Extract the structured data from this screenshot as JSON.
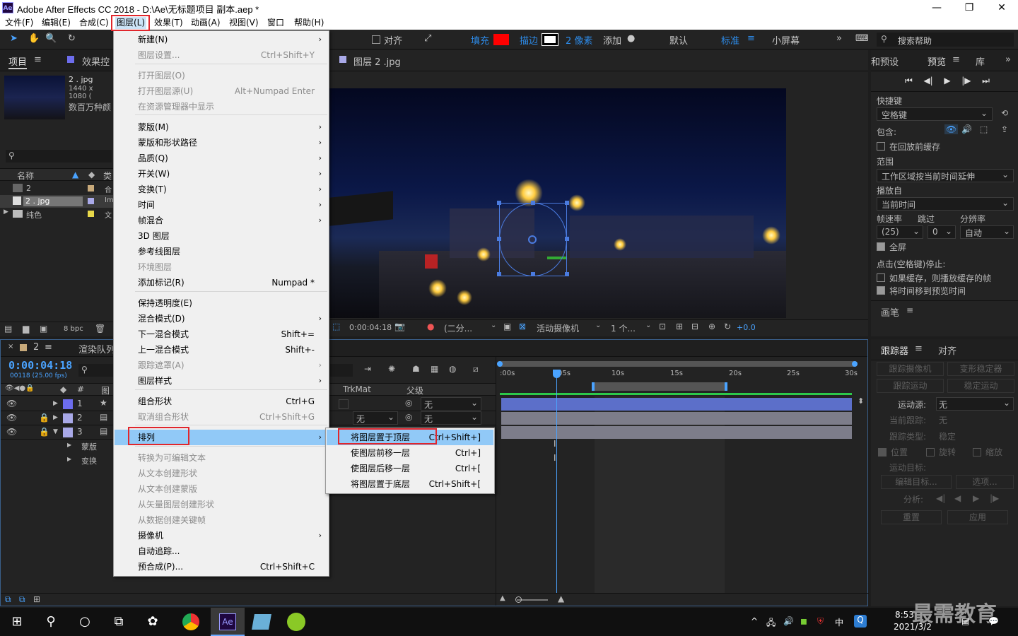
{
  "window": {
    "title": "Adobe After Effects CC 2018 - D:\\Ae\\无标题项目 副本.aep *",
    "logo": "Ae",
    "minimize": "—",
    "maximize": "❐",
    "close": "✕"
  },
  "menubar": [
    "文件(F)",
    "编辑(E)",
    "合成(C)",
    "图层(L)",
    "效果(T)",
    "动画(A)",
    "视图(V)",
    "窗口",
    "帮助(H)"
  ],
  "toolbar": {
    "align": "对齐",
    "fill": "填充",
    "stroke": "描边",
    "stroke_px": "2 像素",
    "add": "添加",
    "default": "默认",
    "standard": "标准",
    "small_screen": "小屏幕",
    "search_placeholder": "搜索帮助"
  },
  "project": {
    "tab": "项目",
    "effects_tab": "效果控",
    "item_name": "2 . jpg",
    "item_dims": "1440 x 1080 (",
    "item_desc": "数百万种颜",
    "col_name": "名称",
    "col_type": "类",
    "bpc": "8 bpc",
    "items": [
      {
        "name": "2",
        "t": "合"
      },
      {
        "name": "2 . jpg",
        "t": "Im"
      },
      {
        "name": "纯色",
        "t": "文"
      }
    ]
  },
  "comp_viewer": {
    "tab": "图层 2 .jpg",
    "timecode": "0:00:04:18",
    "resolution": "(二分...",
    "camera": "活动摄像机",
    "views": "1 个...",
    "exposure": "+0.0"
  },
  "layer_menu": {
    "items": [
      {
        "label": "新建(N)",
        "arrow": true
      },
      {
        "label": "图层设置...",
        "shortcut": "Ctrl+Shift+Y",
        "disabled": true
      },
      {
        "label": "打开图层(O)",
        "disabled": true
      },
      {
        "label": "打开图层源(U)",
        "shortcut": "Alt+Numpad Enter",
        "disabled": true
      },
      {
        "label": "在资源管理器中显示",
        "disabled": true
      },
      {
        "label": "蒙版(M)",
        "arrow": true
      },
      {
        "label": "蒙版和形状路径",
        "arrow": true
      },
      {
        "label": "品质(Q)",
        "arrow": true
      },
      {
        "label": "开关(W)",
        "arrow": true
      },
      {
        "label": "变换(T)",
        "arrow": true
      },
      {
        "label": "时间",
        "arrow": true
      },
      {
        "label": "帧混合",
        "arrow": true
      },
      {
        "label": "3D 图层"
      },
      {
        "label": "参考线图层"
      },
      {
        "label": "环境图层",
        "disabled": true
      },
      {
        "label": "添加标记(R)",
        "shortcut": "Numpad *"
      },
      {
        "label": "保持透明度(E)"
      },
      {
        "label": "混合模式(D)",
        "arrow": true
      },
      {
        "label": "下一混合模式",
        "shortcut": "Shift+="
      },
      {
        "label": "上一混合模式",
        "shortcut": "Shift+-"
      },
      {
        "label": "跟踪遮罩(A)",
        "arrow": true,
        "disabled": true
      },
      {
        "label": "图层样式",
        "arrow": true
      },
      {
        "label": "组合形状",
        "shortcut": "Ctrl+G"
      },
      {
        "label": "取消组合形状",
        "shortcut": "Ctrl+Shift+G",
        "disabled": true
      },
      {
        "label": "排列",
        "arrow": true
      },
      {
        "label": "转换为可编辑文本",
        "disabled": true
      },
      {
        "label": "从文本创建形状",
        "disabled": true
      },
      {
        "label": "从文本创建蒙版",
        "disabled": true
      },
      {
        "label": "从矢量图层创建形状",
        "disabled": true
      },
      {
        "label": "从数据创建关键帧",
        "disabled": true
      },
      {
        "label": "摄像机",
        "arrow": true
      },
      {
        "label": "自动追踪..."
      },
      {
        "label": "预合成(P)...",
        "shortcut": "Ctrl+Shift+C"
      }
    ]
  },
  "arrange_submenu": [
    {
      "label": "将图层置于顶层",
      "shortcut": "Ctrl+Shift+]"
    },
    {
      "label": "使图层前移一层",
      "shortcut": "Ctrl+]"
    },
    {
      "label": "使图层后移一层",
      "shortcut": "Ctrl+["
    },
    {
      "label": "将图层置于底层",
      "shortcut": "Ctrl+Shift+["
    }
  ],
  "timeline": {
    "tab_comp": "2",
    "tab_render": "渲染队列",
    "timecode": "0:00:04:18",
    "fps": "00118 (25.00 fps)",
    "col_num": "#",
    "col_trkmat": "TrkMat",
    "col_parent": "父级",
    "layers": [
      {
        "n": "1",
        "parent": "无",
        "trk": ""
      },
      {
        "n": "2",
        "parent": "无",
        "trk": "无"
      },
      {
        "n": "3",
        "parent": "",
        "trk": ""
      }
    ],
    "sub_mask": "蒙版",
    "sub_transform": "变换",
    "ruler": [
      ":00s",
      "05s",
      "10s",
      "15s",
      "20s",
      "25s",
      "30s"
    ]
  },
  "right_panel": {
    "tab_effects": "和预设",
    "tab_preview": "预览",
    "tab_lib": "库",
    "shortcut_label": "快捷键",
    "shortcut_val": "空格键",
    "include": "包含:",
    "cache": "在回放前缓存",
    "range": "范围",
    "range_val": "工作区域按当前时间延伸",
    "play_from": "播放自",
    "play_from_val": "当前时间",
    "fps": "帧速率",
    "skip": "跳过",
    "res": "分辨率",
    "fps_val": "(25)",
    "skip_val": "0",
    "res_val": "自动",
    "fullscreen": "全屏",
    "stop_note": "点击(空格键)停止:",
    "if_cache": "如果缓存，则播放缓存的帧",
    "move_time": "将时间移到预览时间",
    "brush": "画笔",
    "tracker": "跟踪器",
    "align_tab": "对齐",
    "track_camera": "跟踪摄像机",
    "warp_stab": "变形稳定器",
    "track_motion": "跟踪运动",
    "stabilize": "稳定运动",
    "motion_src": "运动源:",
    "motion_src_val": "无",
    "cur_track": "当前跟踪:",
    "cur_track_val": "无",
    "track_type": "跟踪类型:",
    "track_type_val": "稳定",
    "pos": "位置",
    "rot": "旋转",
    "scale": "缩放",
    "target": "运动目标:",
    "edit_target": "编辑目标...",
    "options": "选项...",
    "analyze": "分析:",
    "reset": "重置",
    "apply": "应用"
  },
  "taskbar": {
    "time": "8:53",
    "date": "2021/3/2",
    "ime": "中",
    "watermark": "最需教育"
  },
  "colors": {
    "accent": "#2d8ceb",
    "fill": "#ff0000",
    "highlight": "#91c9f7",
    "redbox": "#e0262c"
  }
}
